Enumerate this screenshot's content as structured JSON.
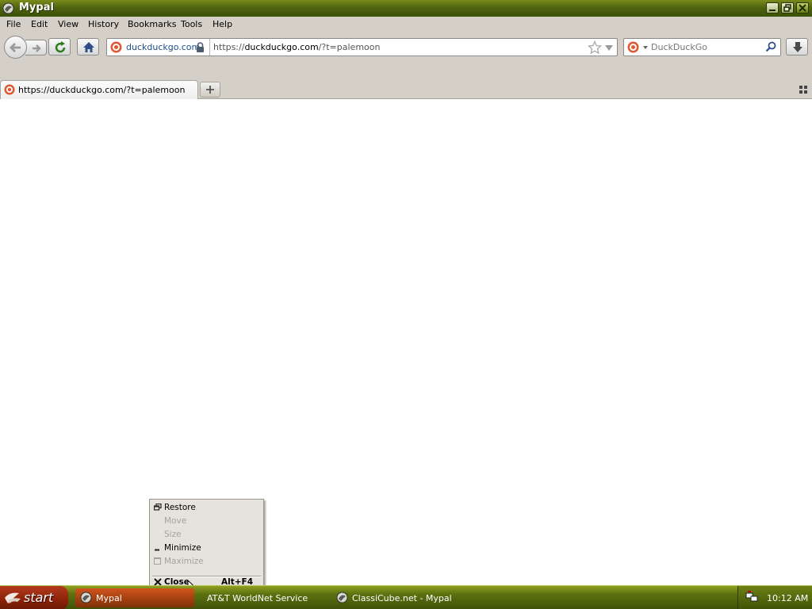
{
  "window": {
    "title": "Mypal"
  },
  "menubar": {
    "items": [
      {
        "label": "File"
      },
      {
        "label": "Edit"
      },
      {
        "label": "View"
      },
      {
        "label": "History"
      },
      {
        "label": "Bookmarks"
      },
      {
        "label": "Tools"
      },
      {
        "label": "Help"
      }
    ]
  },
  "navbar": {
    "identity_host": "duckduckgo.com",
    "url_prefix": "https://",
    "url_domain": "duckduckgo.com",
    "url_suffix": "/?t=palemoon",
    "search_placeholder": "DuckDuckGo"
  },
  "tabs": [
    {
      "label": "https://duckduckgo.com/?t=palemoon"
    }
  ],
  "system_menu": {
    "items": [
      {
        "label": "Restore",
        "enabled": true,
        "icon": "restore-icon"
      },
      {
        "label": "Move",
        "enabled": false
      },
      {
        "label": "Size",
        "enabled": false
      },
      {
        "label": "Minimize",
        "enabled": true,
        "icon": "minimize-icon"
      },
      {
        "label": "Maximize",
        "enabled": false,
        "icon": "maximize-icon"
      },
      {
        "label": "Close",
        "enabled": true,
        "icon": "close-icon",
        "accelerator": "Alt+F4"
      }
    ]
  },
  "taskbar": {
    "start_label": "start",
    "tasks": [
      {
        "label": "Mypal",
        "active": true
      },
      {
        "label": "AT&T WorldNet Service",
        "active": false
      },
      {
        "label": "ClassiCube.net - Mypal",
        "active": false
      }
    ],
    "clock": "10:12 AM"
  },
  "colors": {
    "titlebar": "#4f6410",
    "taskbar": "#5d7110",
    "start_button": "#8a2308",
    "chrome_gray": "#d4d0c8",
    "url_host": "#1a4d8c"
  }
}
